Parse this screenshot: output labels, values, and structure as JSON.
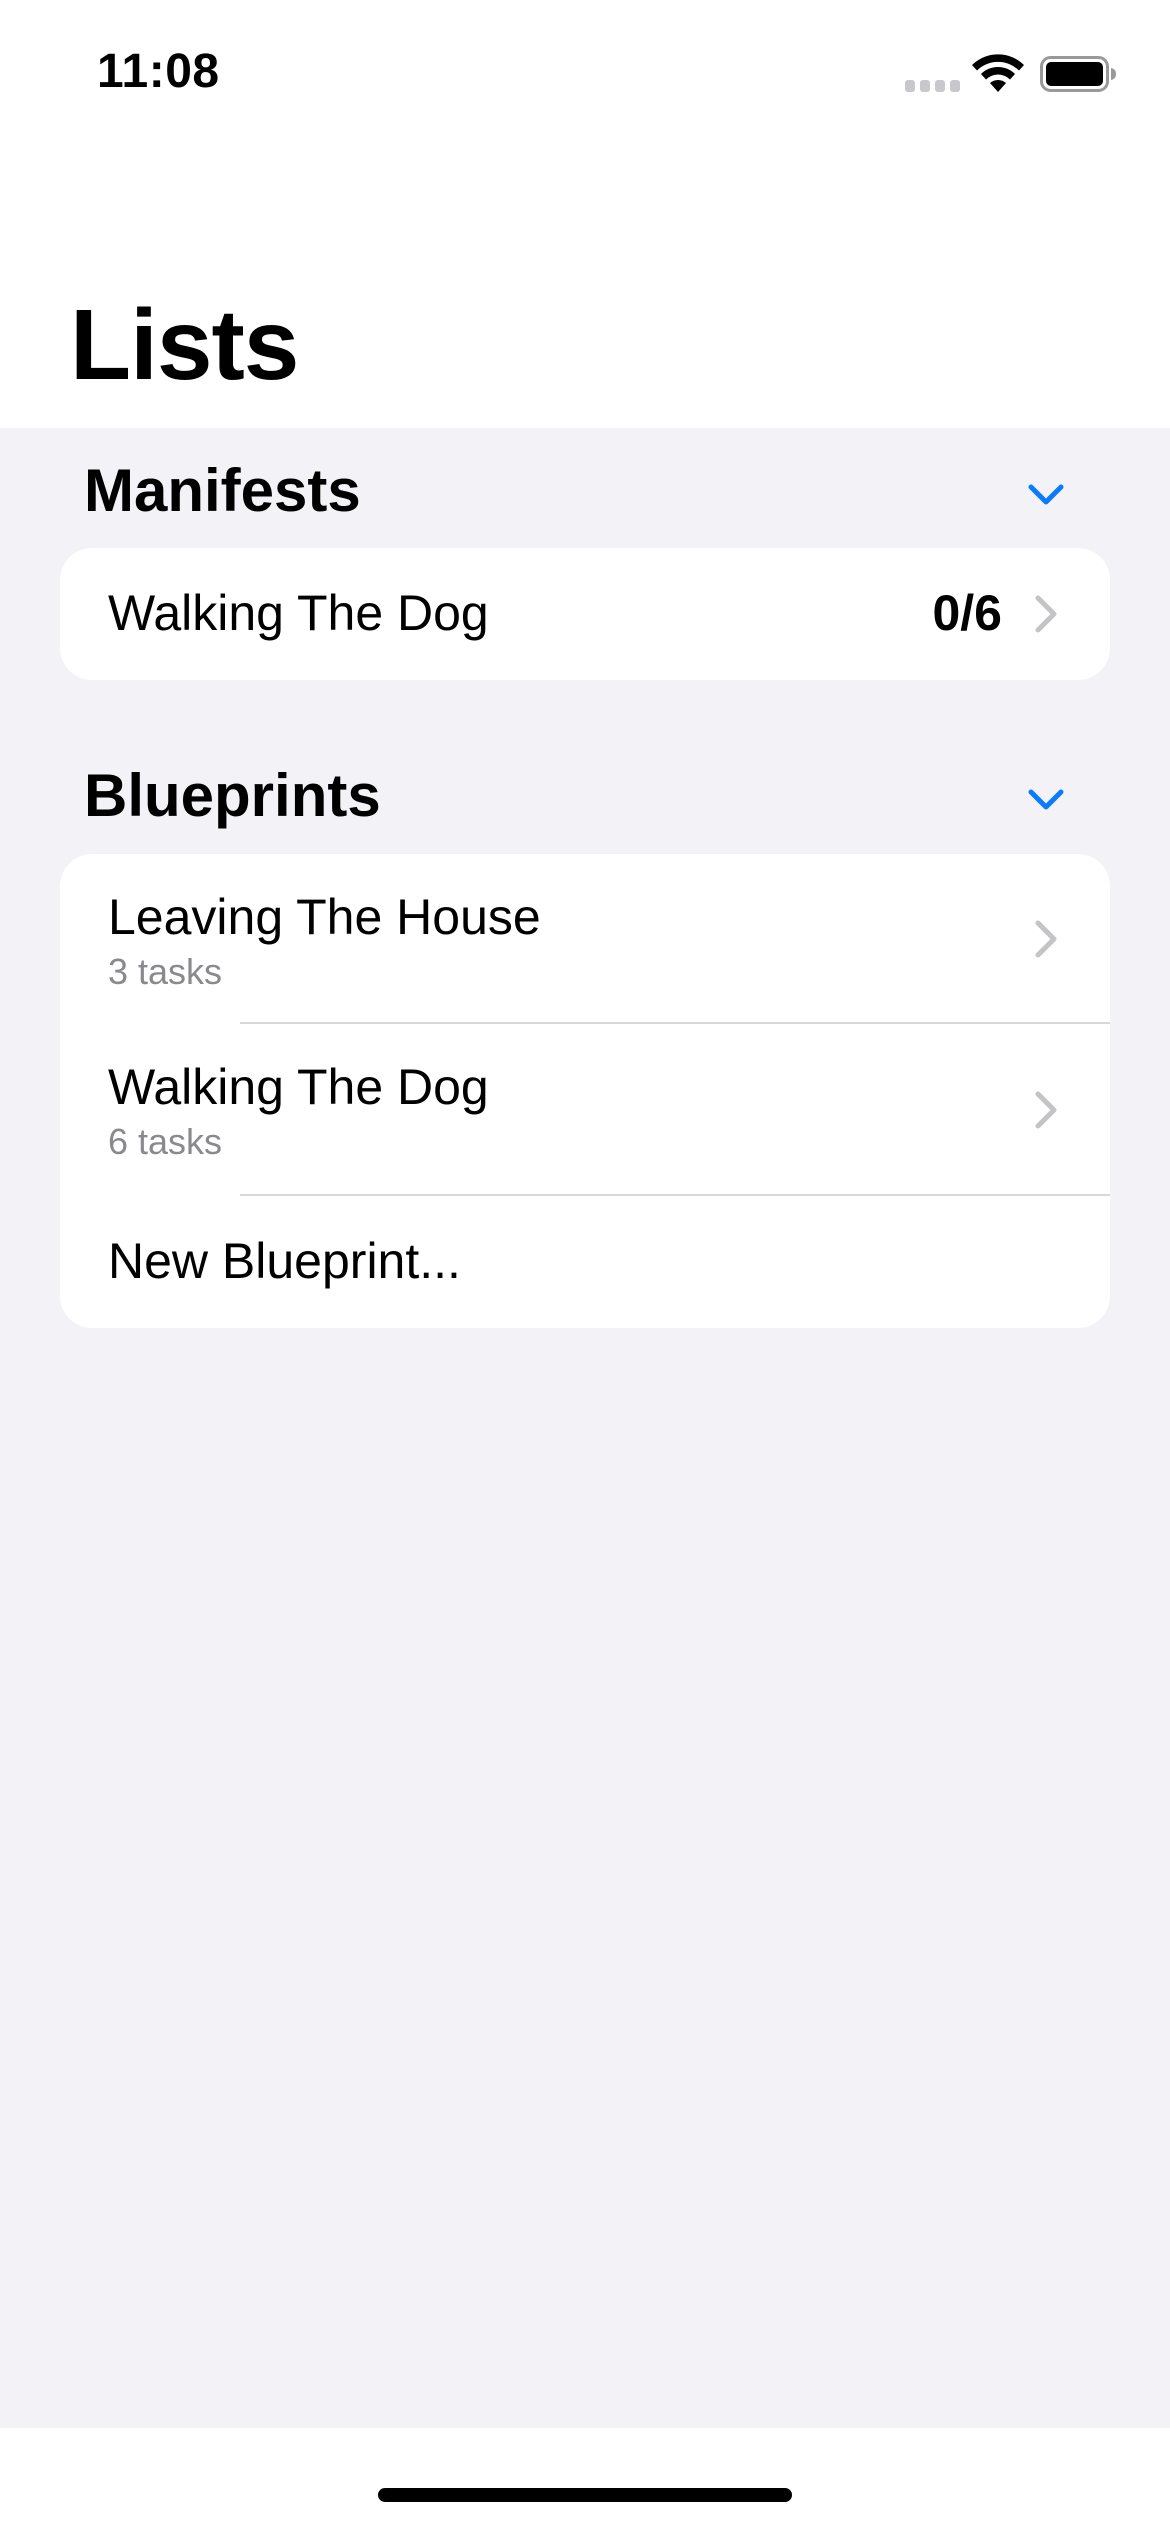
{
  "status_bar": {
    "time": "11:08"
  },
  "nav": {
    "title": "Lists"
  },
  "sections": {
    "manifests": {
      "title": "Manifests",
      "items": [
        {
          "title": "Walking The Dog",
          "count": "0/6"
        }
      ]
    },
    "blueprints": {
      "title": "Blueprints",
      "items": [
        {
          "title": "Leaving The House",
          "subtitle": "3 tasks"
        },
        {
          "title": "Walking The Dog",
          "subtitle": "6 tasks"
        }
      ],
      "new_label": "New Blueprint..."
    }
  },
  "icons": {
    "status": [
      "cellular-signal-icon",
      "wifi-icon",
      "battery-icon"
    ],
    "section": "chevron-down-icon",
    "row": "chevron-right-icon"
  },
  "colors": {
    "accent": "#0A7AFF",
    "background": "#F2F2F7",
    "card": "#FFFFFF",
    "secondary_text": "#8A8A8E",
    "disclosure": "#C4C4C7"
  }
}
